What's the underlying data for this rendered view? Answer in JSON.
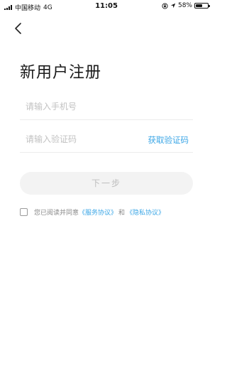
{
  "status_bar": {
    "carrier": "中国移动",
    "network": "4G",
    "time": "11:05",
    "battery_percent_text": "58%",
    "battery_level": 0.58
  },
  "page": {
    "title": "新用户注册"
  },
  "form": {
    "phone_placeholder": "请输入手机号",
    "code_placeholder": "请输入验证码",
    "get_code_label": "获取验证码",
    "next_label": "下一步"
  },
  "agreement": {
    "prefix": "您已阅读并同意",
    "service_link": "《服务协议》",
    "conjunction": "和",
    "privacy_link": "《隐私协议》"
  },
  "colors": {
    "accent": "#3ba6e6",
    "disabled_button_bg": "#f3f3f3",
    "disabled_button_text": "#bdbdbd"
  },
  "icons": {
    "back": "chevron-left-icon",
    "orientation_lock": "orientation-lock-icon",
    "location": "location-arrow-icon"
  }
}
